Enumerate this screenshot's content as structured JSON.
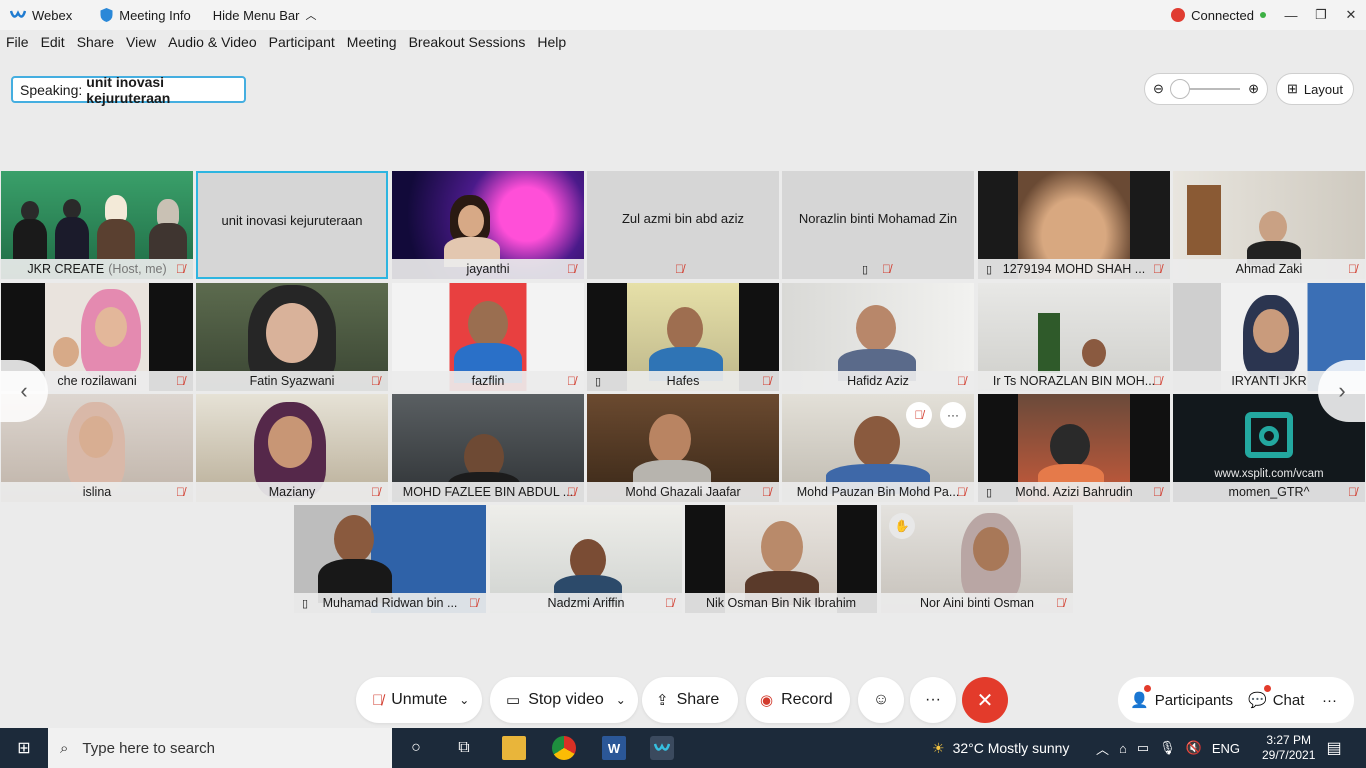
{
  "titlebar": {
    "app_name": "Webex",
    "meeting_info": "Meeting Info",
    "hide_menu": "Hide Menu Bar",
    "status": "Connected"
  },
  "menu": [
    "File",
    "Edit",
    "Share",
    "View",
    "Audio & Video",
    "Participant",
    "Meeting",
    "Breakout Sessions",
    "Help"
  ],
  "speaking": {
    "label": "Speaking:",
    "name": "unit inovasi kejuruteraan"
  },
  "layout_label": "Layout",
  "participants": [
    {
      "name": "JKR CREATE",
      "host": "(Host, me)",
      "video": true,
      "muted": true
    },
    {
      "name": "unit inovasi kejuruteraan",
      "video": false,
      "active": true
    },
    {
      "name": "jayanthi",
      "video": true,
      "muted": true
    },
    {
      "name": "Zul azmi bin abd aziz",
      "video": false,
      "muted": true
    },
    {
      "name": "Norazlin binti Mohamad Zin",
      "video": false,
      "muted": true,
      "phone": true
    },
    {
      "name": "1279194 MOHD SHAH ...",
      "video": true,
      "muted": true,
      "phone": true
    },
    {
      "name": "Ahmad Zaki",
      "video": true,
      "muted": true
    },
    {
      "name": "che rozilawani",
      "video": true,
      "muted": true
    },
    {
      "name": "Fatin Syazwani",
      "video": true,
      "muted": true
    },
    {
      "name": "fazflin",
      "video": true,
      "muted": true
    },
    {
      "name": "Hafes",
      "video": true,
      "muted": true,
      "phone": true
    },
    {
      "name": "Hafidz Aziz",
      "video": true,
      "muted": true
    },
    {
      "name": "Ir Ts NORAZLAN BIN MOH...",
      "video": true,
      "muted": true
    },
    {
      "name": "IRYANTI JKR",
      "video": true,
      "muted": false
    },
    {
      "name": "islina",
      "video": true,
      "muted": true
    },
    {
      "name": "Maziany",
      "video": true,
      "muted": true
    },
    {
      "name": "MOHD FAZLEE BIN ABDUL ...",
      "video": true,
      "muted": true
    },
    {
      "name": "Mohd Ghazali Jaafar",
      "video": true,
      "muted": true
    },
    {
      "name": "Mohd Pauzan Bin Mohd Pa...",
      "video": true,
      "muted": true
    },
    {
      "name": "Mohd. Azizi Bahrudin",
      "video": true,
      "muted": true,
      "phone": true
    },
    {
      "name": "momen_GTR^",
      "video": true,
      "muted": true,
      "overlay": "www.xsplit.com/vcam"
    },
    {
      "name": "Muhamad Ridwan bin ...",
      "video": true,
      "muted": true,
      "phone": true
    },
    {
      "name": "Nadzmi Ariffin",
      "video": true,
      "muted": true
    },
    {
      "name": "Nik Osman Bin Nik Ibrahim",
      "video": true,
      "muted": false
    },
    {
      "name": "Nor Aini binti Osman",
      "video": true,
      "muted": true
    }
  ],
  "controls": {
    "unmute": "Unmute",
    "stop_video": "Stop video",
    "share": "Share",
    "record": "Record",
    "participants": "Participants",
    "chat": "Chat"
  },
  "taskbar": {
    "search_placeholder": "Type here to search",
    "weather": "32°C  Mostly sunny",
    "lang": "ENG",
    "time": "3:27 PM",
    "date": "29/7/2021"
  },
  "colors": {
    "accent": "#2db5e0",
    "end_call": "#e33b2b",
    "muted_red": "#d23b2d",
    "taskbar": "#1c2a3a"
  }
}
